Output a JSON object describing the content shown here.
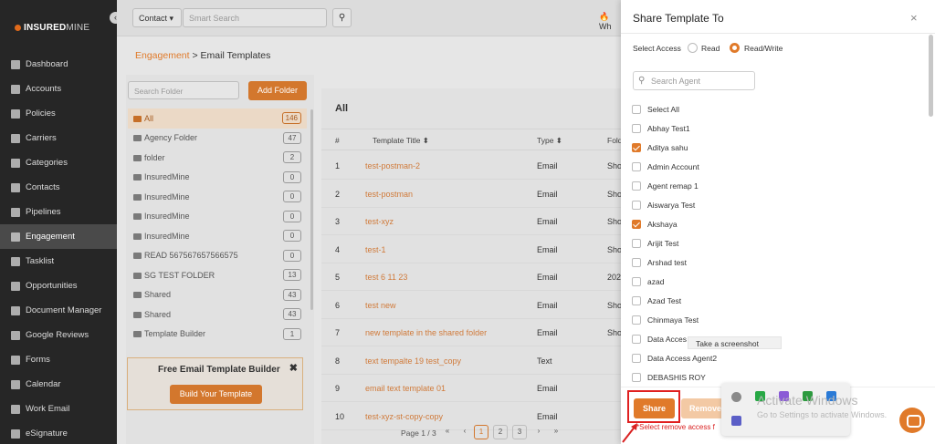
{
  "sidebar": {
    "logo": "INSUREDMINE",
    "logo_bold": "INSURED",
    "logo_light": "MINE",
    "items": [
      {
        "label": "Dashboard",
        "icon": "dashboard-icon"
      },
      {
        "label": "Accounts",
        "icon": "accounts-icon"
      },
      {
        "label": "Policies",
        "icon": "policies-icon"
      },
      {
        "label": "Carriers",
        "icon": "carriers-icon"
      },
      {
        "label": "Categories",
        "icon": "categories-icon"
      },
      {
        "label": "Contacts",
        "icon": "contacts-icon"
      },
      {
        "label": "Pipelines",
        "icon": "pipelines-icon"
      },
      {
        "label": "Engagement",
        "icon": "engagement-icon",
        "active": true
      },
      {
        "label": "Tasklist",
        "icon": "tasklist-icon"
      },
      {
        "label": "Opportunities",
        "icon": "opportunities-icon"
      },
      {
        "label": "Document Manager",
        "icon": "document-icon"
      },
      {
        "label": "Google Reviews",
        "icon": "google-icon"
      },
      {
        "label": "Forms",
        "icon": "forms-icon"
      },
      {
        "label": "Calendar",
        "icon": "calendar-icon"
      },
      {
        "label": "Work Email",
        "icon": "email-icon"
      },
      {
        "label": "eSignature",
        "icon": "signature-icon"
      }
    ]
  },
  "topbar": {
    "select": "Contact",
    "search_placeholder": "Smart Search",
    "wh": "Wh"
  },
  "breadcrumb": {
    "parent": "Engagement",
    "current": "Email Templates"
  },
  "folders": {
    "search_placeholder": "Search Folder",
    "add_label": "Add Folder",
    "items": [
      {
        "name": "All",
        "count": "146"
      },
      {
        "name": "Agency Folder",
        "count": "47"
      },
      {
        "name": "folder",
        "count": "2"
      },
      {
        "name": "InsuredMine",
        "count": "0"
      },
      {
        "name": "InsuredMine",
        "count": "0"
      },
      {
        "name": "InsuredMine",
        "count": "0"
      },
      {
        "name": "InsuredMine",
        "count": "0"
      },
      {
        "name": "READ 567567657566575",
        "count": "0"
      },
      {
        "name": "SG TEST FOLDER",
        "count": "13"
      },
      {
        "name": "Shared",
        "count": "43"
      },
      {
        "name": "Shared",
        "count": "43"
      },
      {
        "name": "Template Builder",
        "count": "1"
      }
    ]
  },
  "promo": {
    "title": "Free Email Template Builder",
    "button": "Build Your Template",
    "close": "✖"
  },
  "table": {
    "heading": "All",
    "headers": {
      "num": "#",
      "title": "Template Title ⬍",
      "type": "Type ⬍",
      "folder": "Fold"
    },
    "rows": [
      {
        "n": "1",
        "title": "test-postman-2",
        "type": "Email",
        "folder": "Sho"
      },
      {
        "n": "2",
        "title": "test-postman",
        "type": "Email",
        "folder": "Sho"
      },
      {
        "n": "3",
        "title": "test-xyz",
        "type": "Email",
        "folder": "Sho"
      },
      {
        "n": "4",
        "title": "test-1",
        "type": "Email",
        "folder": "Sho"
      },
      {
        "n": "5",
        "title": "test 6 11 23",
        "type": "Email",
        "folder": "202"
      },
      {
        "n": "6",
        "title": "test new",
        "type": "Email",
        "folder": "Sho"
      },
      {
        "n": "7",
        "title": "new template in the shared folder",
        "type": "Email",
        "folder": "Sho"
      },
      {
        "n": "8",
        "title": "text tempalte 19 test_copy",
        "type": "Text",
        "folder": ""
      },
      {
        "n": "9",
        "title": "email text template 01",
        "type": "Email",
        "folder": ""
      },
      {
        "n": "10",
        "title": "test-xyz-st-copy-copy",
        "type": "Email",
        "folder": ""
      }
    ],
    "pager": {
      "label": "Page 1 / 3",
      "first": "«",
      "prev": "‹",
      "p1": "1",
      "p2": "2",
      "p3": "3",
      "next": "›",
      "last": "»"
    }
  },
  "modal": {
    "title": "Share Template To",
    "close": "×",
    "access_label": "Select Access",
    "read_label": "Read",
    "readwrite_label": "Read/Write",
    "search_placeholder": "Search Agent",
    "agents": [
      {
        "name": "Select All",
        "checked": false
      },
      {
        "name": "Abhay Test1",
        "checked": false
      },
      {
        "name": "Aditya sahu",
        "checked": true
      },
      {
        "name": "Admin Account",
        "checked": false
      },
      {
        "name": "Agent remap 1",
        "checked": false
      },
      {
        "name": "Aiswarya Test",
        "checked": false
      },
      {
        "name": "Akshaya",
        "checked": true
      },
      {
        "name": "Arijit Test",
        "checked": false
      },
      {
        "name": "Arshad test",
        "checked": false
      },
      {
        "name": "azad",
        "checked": false
      },
      {
        "name": "Azad Test",
        "checked": false
      },
      {
        "name": "Chinmaya Test",
        "checked": false
      },
      {
        "name": "Data Acces",
        "checked": false
      },
      {
        "name": "Data Access Agent2",
        "checked": false
      },
      {
        "name": "DEBASHIS ROY",
        "checked": false
      }
    ],
    "tooltip": "Take a screenshot",
    "share_label": "Share",
    "remove_label": "Remove",
    "error": "*Select remove access f"
  },
  "windows": {
    "activate": "Activate Windows",
    "activate_sub": "Go to Settings to activate Windows."
  },
  "colors": {
    "accent": "#e07a2a",
    "sidebar": "#262626",
    "error": "#d92121"
  }
}
